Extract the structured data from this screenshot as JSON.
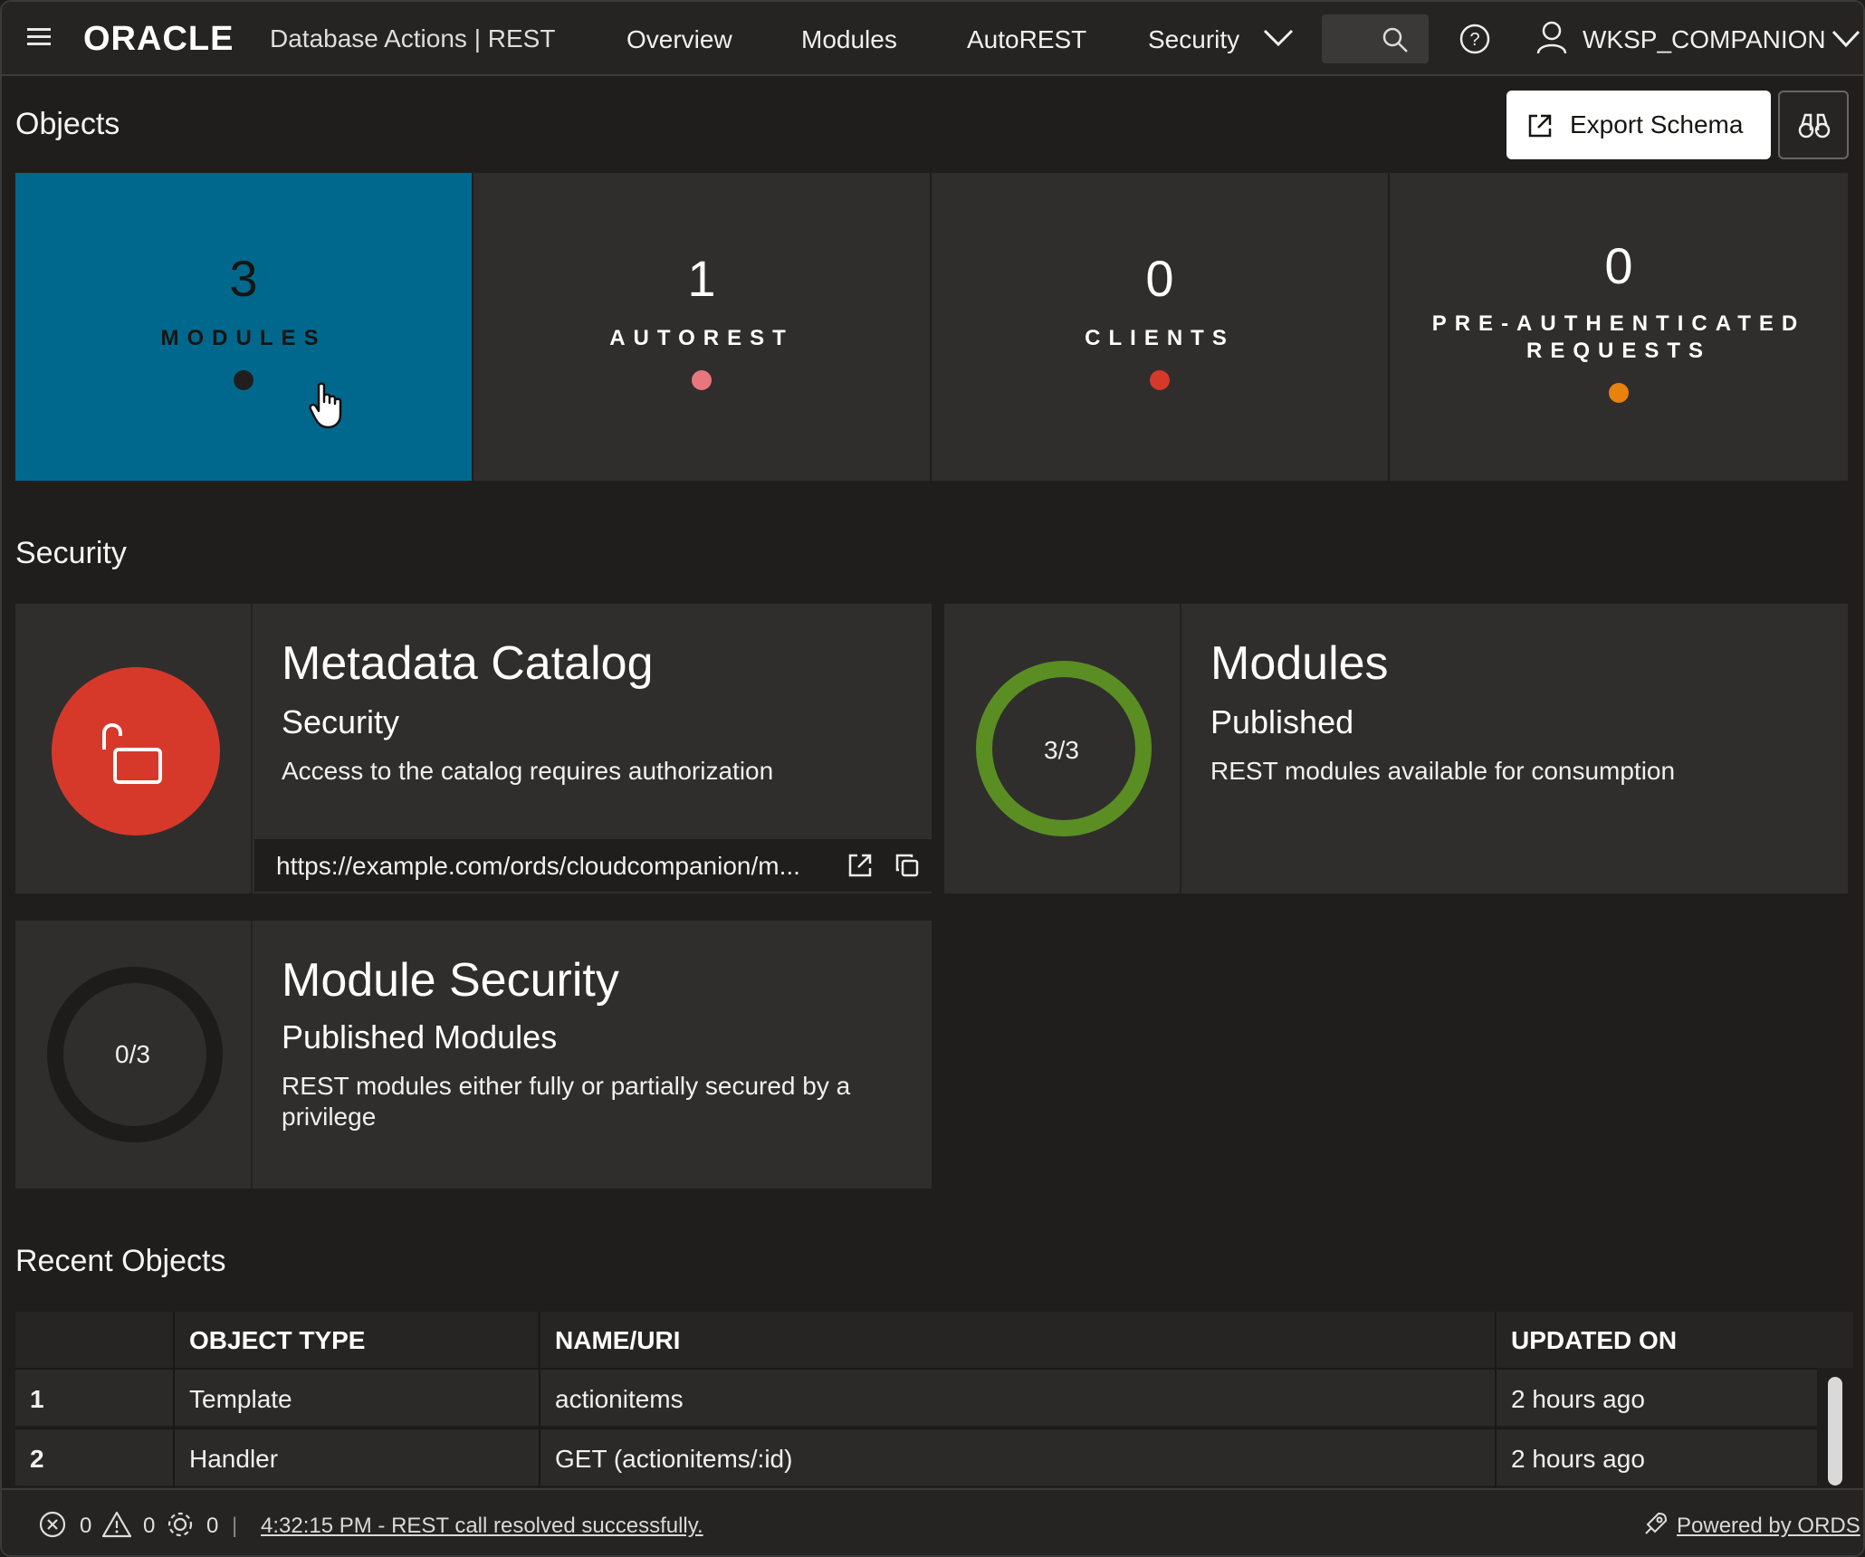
{
  "header": {
    "brand": "ORACLE",
    "brand_sub": "Database Actions |  REST",
    "nav": [
      "Overview",
      "Modules",
      "AutoREST",
      "Security"
    ],
    "user": "WKSP_COMPANION"
  },
  "objects": {
    "title": "Objects",
    "export_label": "Export Schema",
    "tiles": [
      {
        "count": "3",
        "label": "MODULES",
        "dot_color": "#1f1f1f"
      },
      {
        "count": "1",
        "label": "AUTOREST",
        "dot_color": "#e8767d"
      },
      {
        "count": "0",
        "label": "CLIENTS",
        "dot_color": "#d6392a"
      },
      {
        "count": "0",
        "label": "PRE-AUTHENTICATED REQUESTS",
        "dot_color": "#e8820c"
      }
    ]
  },
  "security": {
    "title": "Security",
    "metadata": {
      "title": "Metadata Catalog",
      "subtitle": "Security",
      "description": "Access to the catalog requires authorization",
      "url": "https://example.com/ords/cloudcompanion/m...",
      "icon_color": "#d6392a"
    },
    "modules": {
      "title": "Modules",
      "subtitle": "Published",
      "description": "REST modules available for consumption",
      "ring": "3/3",
      "ring_color": "#5a8e23"
    },
    "module_security": {
      "title": "Module Security",
      "subtitle": "Published Modules",
      "description": "REST modules either fully or partially secured by a privilege",
      "ring": "0/3"
    }
  },
  "recent": {
    "title": "Recent Objects",
    "columns": [
      "OBJECT TYPE",
      "NAME/URI",
      "UPDATED ON"
    ],
    "rows": [
      {
        "idx": "1",
        "type": "Template",
        "name": "actionitems",
        "updated": "2 hours ago"
      },
      {
        "idx": "2",
        "type": "Handler",
        "name": "GET (actionitems/:id)",
        "updated": "2 hours ago"
      }
    ]
  },
  "statusbar": {
    "errors": "0",
    "warnings": "0",
    "tasks": "0",
    "message": "4:32:15 PM - REST call resolved successfully.",
    "powered": "Powered by ORDS"
  }
}
